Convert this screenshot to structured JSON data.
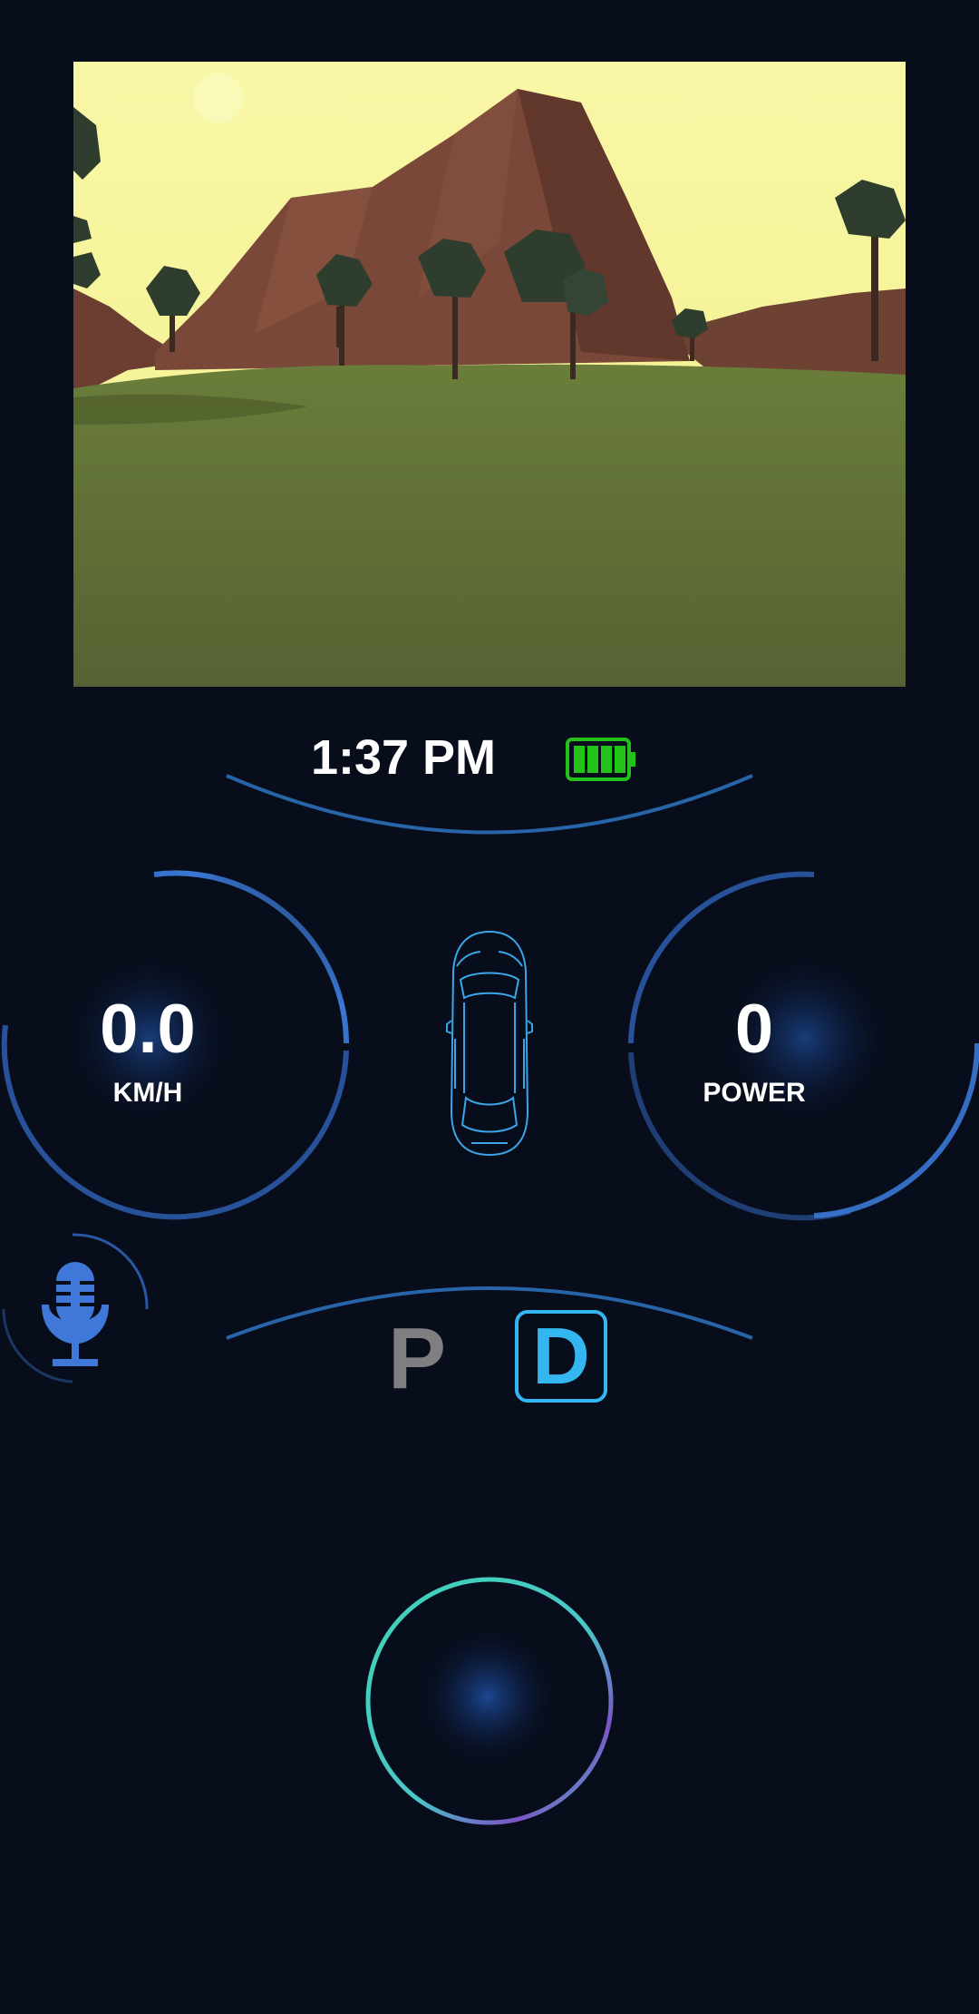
{
  "camera": {
    "sky_color": "#f6f59a",
    "ground_color": "#5b6b34",
    "mountain_color": "#7a4838",
    "tree_color": "#2f3d2e"
  },
  "status": {
    "time": "1:37 PM",
    "battery_icon": "battery-full-icon",
    "battery_level": 1.0,
    "battery_color": "#22c21a"
  },
  "speed_gauge": {
    "value": "0.0",
    "unit": "KM/H"
  },
  "power_gauge": {
    "value": "0",
    "unit": "POWER"
  },
  "car": {
    "icon": "car-top-view-icon",
    "color": "#3aa6e8"
  },
  "mic": {
    "icon": "microphone-icon",
    "color": "#3f78d8"
  },
  "gears": {
    "park": "P",
    "drive": "D",
    "selected": "D",
    "active_color": "#34b7f1",
    "inactive_color": "#7f7f82"
  },
  "joystick": {
    "icon": "joystick-icon"
  },
  "theme": {
    "background": "#080d1b",
    "accent": "#3a7bd5"
  }
}
